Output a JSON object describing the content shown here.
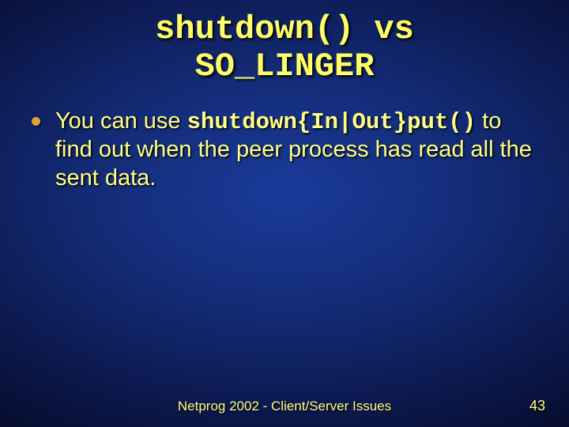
{
  "title": {
    "line1": "shutdown() vs",
    "line2": "SO_LINGER"
  },
  "bullet": {
    "prefix": "You can use ",
    "code": "shutdown{In|Out}put()",
    "suffix": " to find out when the peer process has read all the sent data."
  },
  "footer": {
    "center": "Netprog 2002 - Client/Server Issues",
    "page": "43"
  }
}
